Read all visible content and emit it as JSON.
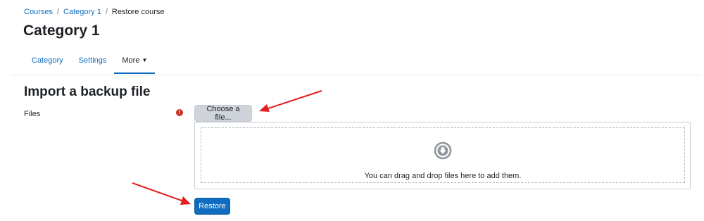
{
  "breadcrumb": {
    "items": [
      "Courses",
      "Category 1"
    ],
    "separator": "/",
    "current": "Restore course"
  },
  "header": {
    "title": "Category 1"
  },
  "tabs": [
    {
      "label": "Category",
      "active": false
    },
    {
      "label": "Settings",
      "active": false
    },
    {
      "label": "More",
      "active": true,
      "icon": "chevron-down-icon"
    }
  ],
  "form": {
    "title": "Import a backup file",
    "files_label": "Files",
    "required_icon": "exclamation-circle-icon",
    "choose_label": "Choose a file...",
    "dropzone_icon": "arrow-circle-down-icon",
    "dropzone_text": "You can drag and drop files here to add them.",
    "restore_label": "Restore"
  },
  "annotations": {
    "arrow_color": "#e31d1d"
  },
  "colors": {
    "accent": "#0f6cbf",
    "required": "#ca3120",
    "secondary_button": "#ced4da"
  }
}
